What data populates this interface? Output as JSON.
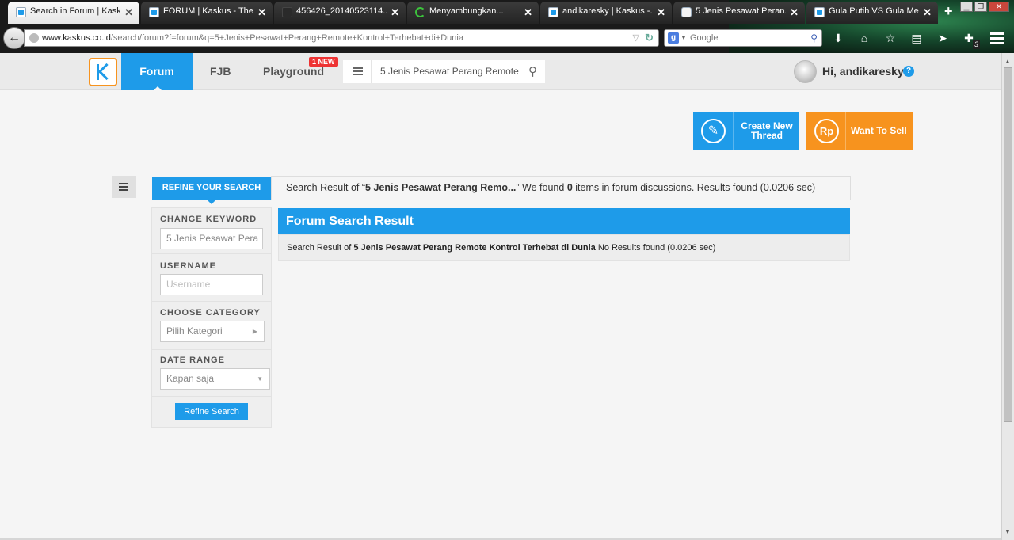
{
  "browser": {
    "tabs": [
      {
        "title": "Search in Forum | Kaskus",
        "active": true
      },
      {
        "title": "FORUM | Kaskus - The..."
      },
      {
        "title": "456426_20140523114..."
      },
      {
        "title": "Menyambungkan..."
      },
      {
        "title": "andikaresky | Kaskus -..."
      },
      {
        "title": "5 Jenis Pesawat Peran..."
      },
      {
        "title": "Gula Putih VS Gula Mer..."
      }
    ],
    "new_tab": "+",
    "url_domain": "www.kaskus.co.id",
    "url_path": "/search/forum?f=forum&q=5+Jenis+Pesawat+Perang+Remote+Kontrol+Terhebat+di+Dunia",
    "search_engine_placeholder": "Google",
    "extension_badge_count": "3"
  },
  "header": {
    "nav_forum": "Forum",
    "nav_fjb": "FJB",
    "nav_playground": "Playground",
    "new_badge": "1 NEW",
    "search_value": "5 Jenis Pesawat Perang Remote",
    "greeting": "Hi, andikaresky",
    "help": "?"
  },
  "actions": {
    "create_thread": "Create New Thread",
    "want_to_sell": "Want To Sell",
    "sell_icon_text": "Rp"
  },
  "refine": {
    "tab_label": "REFINE YOUR SEARCH",
    "keyword_label": "CHANGE KEYWORD",
    "keyword_value": "5 Jenis Pesawat Pera",
    "username_label": "USERNAME",
    "username_placeholder": "Username",
    "category_label": "CHOOSE CATEGORY",
    "category_value": "Pilih Kategori",
    "date_label": "DATE RANGE",
    "date_value": "Kapan saja",
    "button": "Refine Search"
  },
  "summary": {
    "prefix": "Search Result of “",
    "query_short": "5 Jenis Pesawat Perang Remo...",
    "middle": "” We found ",
    "count": "0",
    "suffix": " items in forum discussions. Results found (0.0206 sec)"
  },
  "results": {
    "title": "Forum Search Result",
    "prefix": "Search Result of ",
    "query": "5 Jenis Pesawat Perang Remote Kontrol Terhebat di Dunia",
    "suffix": " No Results found (0.0206 sec)"
  }
}
